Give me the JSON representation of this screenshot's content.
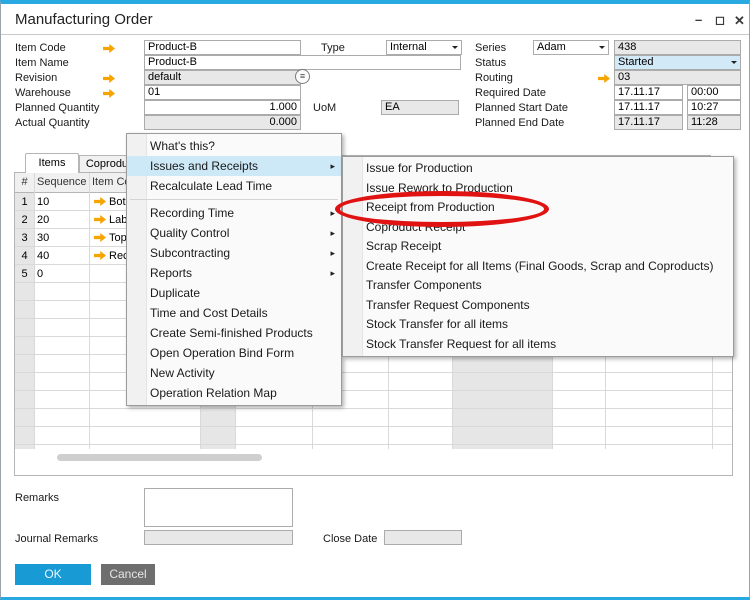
{
  "window": {
    "title": "Manufacturing Order",
    "controls": {
      "minimize": "–",
      "maximize": "◻",
      "close": "✕"
    }
  },
  "icons": {
    "revision_list": "≡",
    "submenu_caret": "▸"
  },
  "form": {
    "item_code": {
      "label": "Item Code",
      "value": "Product-B"
    },
    "item_name": {
      "label": "Item Name",
      "value": "Product-B"
    },
    "revision": {
      "label": "Revision",
      "value": "default"
    },
    "warehouse": {
      "label": "Warehouse",
      "value": "01"
    },
    "planned_quantity": {
      "label": "Planned Quantity",
      "value": "1.000"
    },
    "actual_quantity": {
      "label": "Actual Quantity",
      "value": "0.000"
    },
    "uom": {
      "label": "UoM",
      "value": "EA"
    },
    "type": {
      "label": "Type",
      "value": "Internal"
    },
    "series": {
      "label": "Series",
      "value": "Adam",
      "number": "438"
    },
    "status": {
      "label": "Status",
      "value": "Started"
    },
    "routing": {
      "label": "Routing",
      "value": "03"
    },
    "required_date": {
      "label": "Required Date",
      "date": "17.11.17",
      "time": "00:00"
    },
    "planned_start_date": {
      "label": "Planned Start Date",
      "date": "17.11.17",
      "time": "10:27"
    },
    "planned_end_date": {
      "label": "Planned End Date",
      "date": "17.11.17",
      "time": "11:28"
    }
  },
  "tabs": [
    {
      "label": "Items"
    },
    {
      "label": "Coproducts"
    }
  ],
  "table": {
    "headers": {
      "num": "#",
      "sequence": "Sequence",
      "item_code": "Item Code"
    },
    "rows": [
      {
        "num": "1",
        "sequence": "10",
        "item": "Bot"
      },
      {
        "num": "2",
        "sequence": "20",
        "item": "Lab"
      },
      {
        "num": "3",
        "sequence": "30",
        "item": "Top"
      },
      {
        "num": "4",
        "sequence": "40",
        "item": "Rec"
      },
      {
        "num": "5",
        "sequence": "0",
        "item": ""
      }
    ]
  },
  "context_menu": {
    "items": [
      {
        "label": "What's this?"
      },
      {
        "label": "Issues and Receipts",
        "highlighted": true,
        "has_submenu": true
      },
      {
        "label": "Recalculate Lead Time",
        "separator_after": true
      },
      {
        "label": "Recording Time",
        "has_submenu": true
      },
      {
        "label": "Quality Control",
        "has_submenu": true
      },
      {
        "label": "Subcontracting",
        "has_submenu": true
      },
      {
        "label": "Reports",
        "has_submenu": true
      },
      {
        "label": "Duplicate"
      },
      {
        "label": "Time and Cost Details"
      },
      {
        "label": "Create Semi-finished Products"
      },
      {
        "label": "Open Operation Bind Form"
      },
      {
        "label": "New Activity"
      },
      {
        "label": "Operation Relation Map"
      }
    ]
  },
  "submenu": {
    "items": [
      {
        "label": "Issue for Production"
      },
      {
        "label": "Issue Rework to Production"
      },
      {
        "label": "Receipt from Production",
        "circled": true
      },
      {
        "label": "Coproduct Receipt"
      },
      {
        "label": "Scrap Receipt"
      },
      {
        "label": "Create Receipt for all Items (Final Goods, Scrap and Coproducts)"
      },
      {
        "label": "Transfer Components"
      },
      {
        "label": "Transfer Request Components"
      },
      {
        "label": "Stock Transfer for all items"
      },
      {
        "label": "Stock Transfer Request for all items"
      }
    ]
  },
  "footer": {
    "remarks_label": "Remarks",
    "journal_remarks_label": "Journal Remarks",
    "close_date_label": "Close Date",
    "ok_label": "OK",
    "cancel_label": "Cancel"
  },
  "colors": {
    "window_border": "#29a9e2",
    "menu_highlight": "#cde9f8",
    "link_arrow_orange": "#f7a300",
    "annotation_red": "#e01212",
    "ok_button_blue": "#189ad5",
    "cancel_button_gray": "#6e6e6e",
    "status_field_blue": "#d2e9f7"
  }
}
